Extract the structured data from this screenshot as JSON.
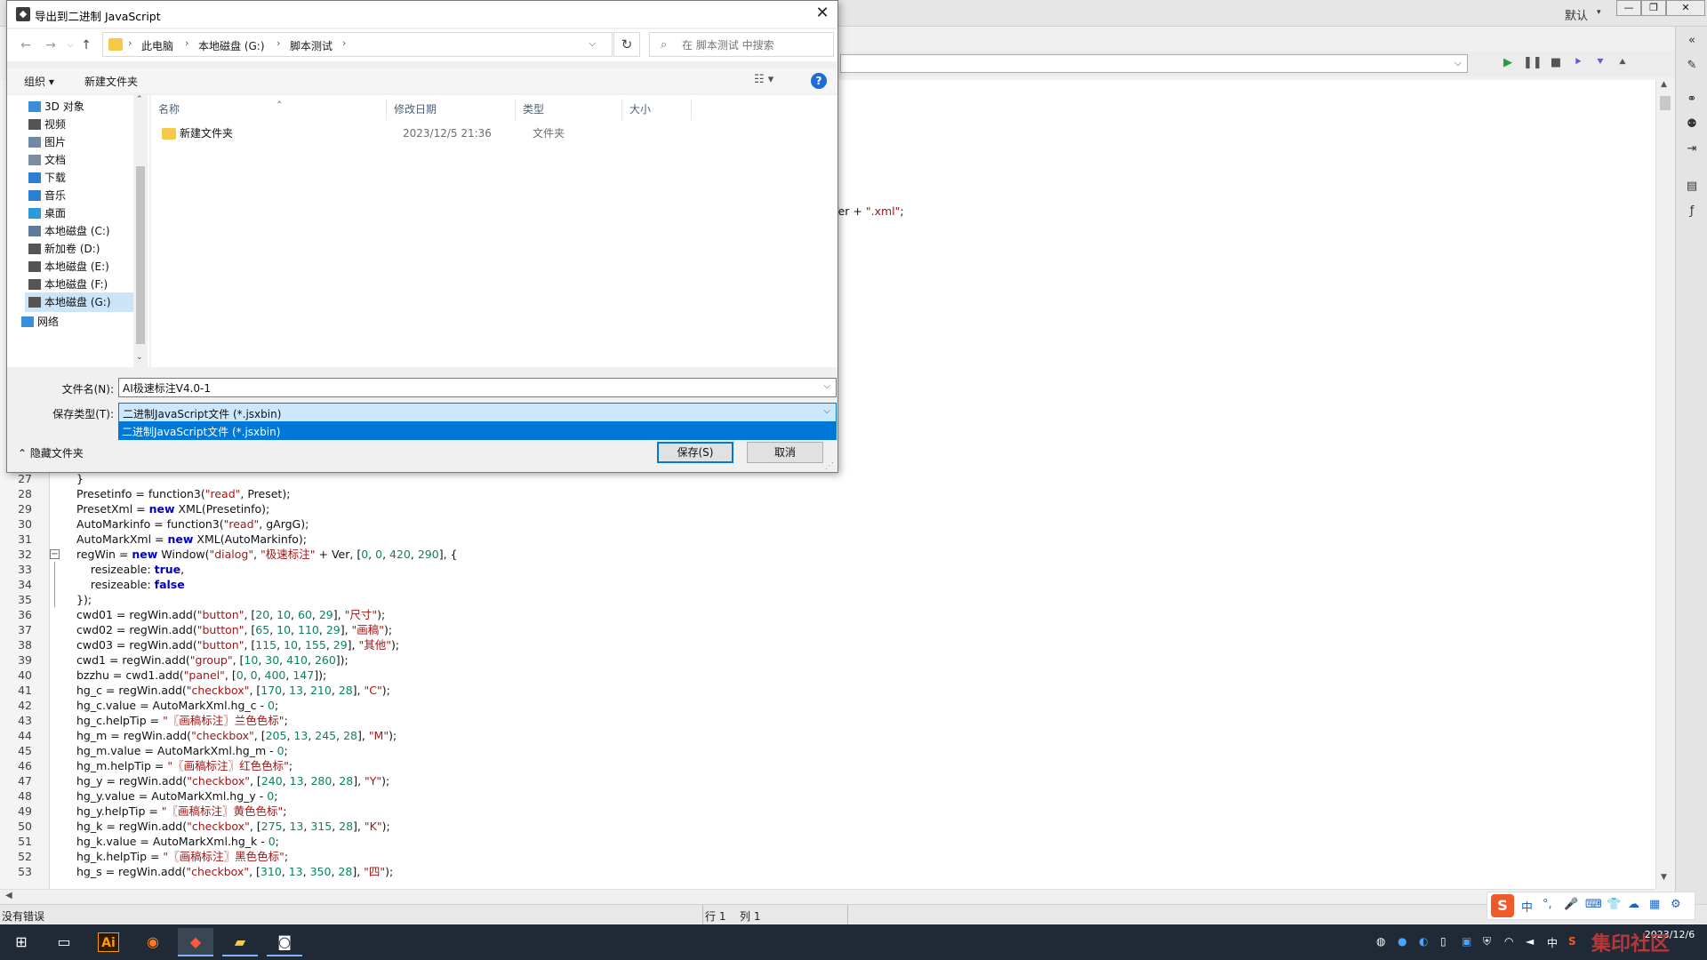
{
  "ide": {
    "workspace": "默认",
    "snippet_pre": "Ver + ",
    "snippet_str": "\".xml\"",
    "snippet_end": ";",
    "code": [
      {
        "ln": "27",
        "fold": "",
        "parts": [
          [
            "p",
            "}"
          ]
        ]
      },
      {
        "ln": "28",
        "fold": "",
        "parts": [
          [
            "p",
            "Presetinfo = function3("
          ],
          [
            "s",
            "\"read\""
          ],
          [
            "p",
            ", Preset);"
          ]
        ]
      },
      {
        "ln": "29",
        "fold": "",
        "parts": [
          [
            "p",
            "PresetXml = "
          ],
          [
            "k",
            "new"
          ],
          [
            "p",
            " XML(Presetinfo);"
          ]
        ]
      },
      {
        "ln": "30",
        "fold": "",
        "parts": [
          [
            "p",
            "AutoMarkinfo = function3("
          ],
          [
            "s",
            "\"read\""
          ],
          [
            "p",
            ", gArgG);"
          ]
        ]
      },
      {
        "ln": "31",
        "fold": "",
        "parts": [
          [
            "p",
            "AutoMarkXml = "
          ],
          [
            "k",
            "new"
          ],
          [
            "p",
            " XML(AutoMarkinfo);"
          ]
        ]
      },
      {
        "ln": "32",
        "fold": "box",
        "parts": [
          [
            "p",
            "regWin = "
          ],
          [
            "k",
            "new"
          ],
          [
            "p",
            " Window("
          ],
          [
            "s",
            "\"dialog\""
          ],
          [
            "p",
            ", "
          ],
          [
            "s",
            "\"极速标注\""
          ],
          [
            "p",
            " + Ver, ["
          ],
          [
            "n",
            "0"
          ],
          [
            "p",
            ", "
          ],
          [
            "n",
            "0"
          ],
          [
            "p",
            ", "
          ],
          [
            "n",
            "420"
          ],
          [
            "p",
            ", "
          ],
          [
            "n",
            "290"
          ],
          [
            "p",
            "], {"
          ]
        ]
      },
      {
        "ln": "33",
        "fold": "line",
        "parts": [
          [
            "p",
            "    resizeable: "
          ],
          [
            "k",
            "true"
          ],
          [
            "p",
            ","
          ]
        ]
      },
      {
        "ln": "34",
        "fold": "line",
        "parts": [
          [
            "p",
            "    resizeable: "
          ],
          [
            "k",
            "false"
          ]
        ]
      },
      {
        "ln": "35",
        "fold": "end",
        "parts": [
          [
            "p",
            "});"
          ]
        ]
      },
      {
        "ln": "36",
        "fold": "",
        "parts": [
          [
            "p",
            "cwd01 = regWin.add("
          ],
          [
            "s",
            "\"button\""
          ],
          [
            "p",
            ", ["
          ],
          [
            "n",
            "20"
          ],
          [
            "p",
            ", "
          ],
          [
            "n",
            "10"
          ],
          [
            "p",
            ", "
          ],
          [
            "n",
            "60"
          ],
          [
            "p",
            ", "
          ],
          [
            "n",
            "29"
          ],
          [
            "p",
            "], "
          ],
          [
            "s",
            "\"尺寸\""
          ],
          [
            "p",
            ");"
          ]
        ]
      },
      {
        "ln": "37",
        "fold": "",
        "parts": [
          [
            "p",
            "cwd02 = regWin.add("
          ],
          [
            "s",
            "\"button\""
          ],
          [
            "p",
            ", ["
          ],
          [
            "n",
            "65"
          ],
          [
            "p",
            ", "
          ],
          [
            "n",
            "10"
          ],
          [
            "p",
            ", "
          ],
          [
            "n",
            "110"
          ],
          [
            "p",
            ", "
          ],
          [
            "n",
            "29"
          ],
          [
            "p",
            "], "
          ],
          [
            "s",
            "\"画稿\""
          ],
          [
            "p",
            ");"
          ]
        ]
      },
      {
        "ln": "38",
        "fold": "",
        "parts": [
          [
            "p",
            "cwd03 = regWin.add("
          ],
          [
            "s",
            "\"button\""
          ],
          [
            "p",
            ", ["
          ],
          [
            "n",
            "115"
          ],
          [
            "p",
            ", "
          ],
          [
            "n",
            "10"
          ],
          [
            "p",
            ", "
          ],
          [
            "n",
            "155"
          ],
          [
            "p",
            ", "
          ],
          [
            "n",
            "29"
          ],
          [
            "p",
            "], "
          ],
          [
            "s",
            "\"其他\""
          ],
          [
            "p",
            ");"
          ]
        ]
      },
      {
        "ln": "39",
        "fold": "",
        "parts": [
          [
            "p",
            "cwd1 = regWin.add("
          ],
          [
            "s",
            "\"group\""
          ],
          [
            "p",
            ", ["
          ],
          [
            "n",
            "10"
          ],
          [
            "p",
            ", "
          ],
          [
            "n",
            "30"
          ],
          [
            "p",
            ", "
          ],
          [
            "n",
            "410"
          ],
          [
            "p",
            ", "
          ],
          [
            "n",
            "260"
          ],
          [
            "p",
            "]);"
          ]
        ]
      },
      {
        "ln": "40",
        "fold": "",
        "parts": [
          [
            "p",
            "bzzhu = cwd1.add("
          ],
          [
            "s",
            "\"panel\""
          ],
          [
            "p",
            ", ["
          ],
          [
            "n",
            "0"
          ],
          [
            "p",
            ", "
          ],
          [
            "n",
            "0"
          ],
          [
            "p",
            ", "
          ],
          [
            "n",
            "400"
          ],
          [
            "p",
            ", "
          ],
          [
            "n",
            "147"
          ],
          [
            "p",
            "]);"
          ]
        ]
      },
      {
        "ln": "41",
        "fold": "",
        "parts": [
          [
            "p",
            "hg_c = regWin.add("
          ],
          [
            "s",
            "\"checkbox\""
          ],
          [
            "p",
            ", ["
          ],
          [
            "n",
            "170"
          ],
          [
            "p",
            ", "
          ],
          [
            "n",
            "13"
          ],
          [
            "p",
            ", "
          ],
          [
            "n",
            "210"
          ],
          [
            "p",
            ", "
          ],
          [
            "n",
            "28"
          ],
          [
            "p",
            "], "
          ],
          [
            "s",
            "\"C\""
          ],
          [
            "p",
            ");"
          ]
        ]
      },
      {
        "ln": "42",
        "fold": "",
        "parts": [
          [
            "p",
            "hg_c.value = AutoMarkXml.hg_c - "
          ],
          [
            "n",
            "0"
          ],
          [
            "p",
            ";"
          ]
        ]
      },
      {
        "ln": "43",
        "fold": "",
        "parts": [
          [
            "p",
            "hg_c.helpTip = "
          ],
          [
            "s",
            "\"〖画稿标注〗兰色色标\""
          ],
          [
            "p",
            ";"
          ]
        ]
      },
      {
        "ln": "44",
        "fold": "",
        "parts": [
          [
            "p",
            "hg_m = regWin.add("
          ],
          [
            "s",
            "\"checkbox\""
          ],
          [
            "p",
            ", ["
          ],
          [
            "n",
            "205"
          ],
          [
            "p",
            ", "
          ],
          [
            "n",
            "13"
          ],
          [
            "p",
            ", "
          ],
          [
            "n",
            "245"
          ],
          [
            "p",
            ", "
          ],
          [
            "n",
            "28"
          ],
          [
            "p",
            "], "
          ],
          [
            "s",
            "\"M\""
          ],
          [
            "p",
            ");"
          ]
        ]
      },
      {
        "ln": "45",
        "fold": "",
        "parts": [
          [
            "p",
            "hg_m.value = AutoMarkXml.hg_m - "
          ],
          [
            "n",
            "0"
          ],
          [
            "p",
            ";"
          ]
        ]
      },
      {
        "ln": "46",
        "fold": "",
        "parts": [
          [
            "p",
            "hg_m.helpTip = "
          ],
          [
            "s",
            "\"〖画稿标注〗红色色标\""
          ],
          [
            "p",
            ";"
          ]
        ]
      },
      {
        "ln": "47",
        "fold": "",
        "parts": [
          [
            "p",
            "hg_y = regWin.add("
          ],
          [
            "s",
            "\"checkbox\""
          ],
          [
            "p",
            ", ["
          ],
          [
            "n",
            "240"
          ],
          [
            "p",
            ", "
          ],
          [
            "n",
            "13"
          ],
          [
            "p",
            ", "
          ],
          [
            "n",
            "280"
          ],
          [
            "p",
            ", "
          ],
          [
            "n",
            "28"
          ],
          [
            "p",
            "], "
          ],
          [
            "s",
            "\"Y\""
          ],
          [
            "p",
            ");"
          ]
        ]
      },
      {
        "ln": "48",
        "fold": "",
        "parts": [
          [
            "p",
            "hg_y.value = AutoMarkXml.hg_y - "
          ],
          [
            "n",
            "0"
          ],
          [
            "p",
            ";"
          ]
        ]
      },
      {
        "ln": "49",
        "fold": "",
        "parts": [
          [
            "p",
            "hg_y.helpTip = "
          ],
          [
            "s",
            "\"〖画稿标注〗黄色色标\""
          ],
          [
            "p",
            ";"
          ]
        ]
      },
      {
        "ln": "50",
        "fold": "",
        "parts": [
          [
            "p",
            "hg_k = regWin.add("
          ],
          [
            "s",
            "\"checkbox\""
          ],
          [
            "p",
            ", ["
          ],
          [
            "n",
            "275"
          ],
          [
            "p",
            ", "
          ],
          [
            "n",
            "13"
          ],
          [
            "p",
            ", "
          ],
          [
            "n",
            "315"
          ],
          [
            "p",
            ", "
          ],
          [
            "n",
            "28"
          ],
          [
            "p",
            "], "
          ],
          [
            "s",
            "\"K\""
          ],
          [
            "p",
            ");"
          ]
        ]
      },
      {
        "ln": "51",
        "fold": "",
        "parts": [
          [
            "p",
            "hg_k.value = AutoMarkXml.hg_k - "
          ],
          [
            "n",
            "0"
          ],
          [
            "p",
            ";"
          ]
        ]
      },
      {
        "ln": "52",
        "fold": "",
        "parts": [
          [
            "p",
            "hg_k.helpTip = "
          ],
          [
            "s",
            "\"〖画稿标注〗黑色色标\""
          ],
          [
            "p",
            ";"
          ]
        ]
      },
      {
        "ln": "53",
        "fold": "",
        "parts": [
          [
            "p",
            "hg_s = regWin.add("
          ],
          [
            "s",
            "\"checkbox\""
          ],
          [
            "p",
            ", ["
          ],
          [
            "n",
            "310"
          ],
          [
            "p",
            ", "
          ],
          [
            "n",
            "13"
          ],
          [
            "p",
            ", "
          ],
          [
            "n",
            "350"
          ],
          [
            "p",
            ", "
          ],
          [
            "n",
            "28"
          ],
          [
            "p",
            "], "
          ],
          [
            "s",
            "\"四\""
          ],
          [
            "p",
            ");"
          ]
        ]
      }
    ],
    "status": {
      "message": "没有错误",
      "row": "行 1",
      "col": "列 1"
    }
  },
  "dialog": {
    "title": "导出到二进制 JavaScript",
    "breadcrumbs": [
      "此电脑",
      "本地磁盘 (G:)",
      "脚本测试"
    ],
    "search_placeholder": "在 脚本测试 中搜索",
    "organize": "组织 ▾",
    "new_folder": "新建文件夹",
    "nav_items": [
      {
        "label": "3D 对象",
        "icon": "cube-icon",
        "color": "#3a8fd8"
      },
      {
        "label": "视频",
        "icon": "video-icon",
        "color": "#555555"
      },
      {
        "label": "图片",
        "icon": "picture-icon",
        "color": "#6f8aa6"
      },
      {
        "label": "文档",
        "icon": "document-icon",
        "color": "#7d8da0"
      },
      {
        "label": "下载",
        "icon": "download-icon",
        "color": "#2d7fd3"
      },
      {
        "label": "音乐",
        "icon": "music-icon",
        "color": "#2d7fd3"
      },
      {
        "label": "桌面",
        "icon": "desktop-icon",
        "color": "#2a9bd8"
      },
      {
        "label": "本地磁盘 (C:)",
        "icon": "windows-drive-icon",
        "color": "#5c7c9a"
      },
      {
        "label": "新加卷 (D:)",
        "icon": "drive-icon",
        "color": "#555555"
      },
      {
        "label": "本地磁盘 (E:)",
        "icon": "drive-icon",
        "color": "#555555"
      },
      {
        "label": "本地磁盘 (F:)",
        "icon": "drive-icon",
        "color": "#555555"
      },
      {
        "label": "本地磁盘 (G:)",
        "icon": "drive-icon",
        "color": "#555555"
      },
      {
        "label": "网络",
        "icon": "network-icon",
        "color": "#3a8fd8"
      }
    ],
    "selected_nav": 11,
    "columns": [
      "名称",
      "修改日期",
      "类型",
      "大小"
    ],
    "files": [
      {
        "name": "新建文件夹",
        "date": "2023/12/5 21:36",
        "type": "文件夹",
        "size": ""
      }
    ],
    "filename_label": "文件名(N):",
    "filename_value": "AI极速标注V4.0-1",
    "filetype_label": "保存类型(T):",
    "filetype_value": "二进制JavaScript文件 (*.jsxbin)",
    "filetype_option": "二进制JavaScript文件 (*.jsxbin)",
    "hide_folders": "隐藏文件夹",
    "save": "保存(S)",
    "cancel": "取消"
  },
  "taskbar": {
    "ai_label": "Ai",
    "tray": [
      "中"
    ],
    "clock_date": "2023/12/6"
  },
  "ime": [
    "中",
    "°,",
    "🎤",
    "⌨",
    "👕",
    "☁",
    "▦",
    "⚙"
  ],
  "watermark": "集印社区",
  "colors": {
    "accent": "#0078d7",
    "keyword": "#0000c8",
    "string": "#a31515",
    "number": "#098658"
  }
}
